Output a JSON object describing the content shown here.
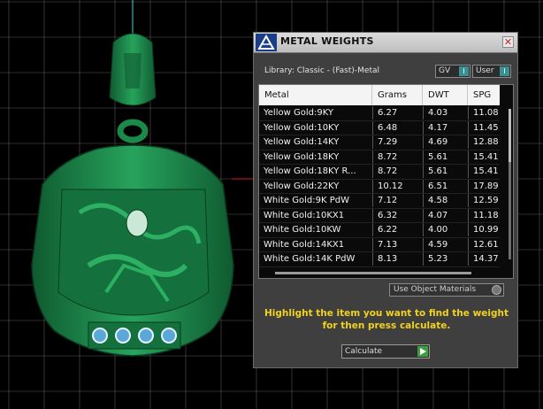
{
  "panel": {
    "title": "METAL WEIGHTS",
    "close_glyph": "✕",
    "library_label": "Library: Classic - (Fast)-Metal",
    "toggles": [
      {
        "label": "GV",
        "knob": "I"
      },
      {
        "label": "User",
        "knob": "I"
      }
    ],
    "table": {
      "headers": [
        "Metal",
        "Grams",
        "DWT",
        "SPG"
      ],
      "rows": [
        [
          "Yellow Gold:9KY",
          "6.27",
          "4.03",
          "11.08"
        ],
        [
          "Yellow Gold:10KY",
          "6.48",
          "4.17",
          "11.45"
        ],
        [
          "Yellow Gold:14KY",
          "7.29",
          "4.69",
          "12.88"
        ],
        [
          "Yellow Gold:18KY",
          "8.72",
          "5.61",
          "15.41"
        ],
        [
          "Yellow Gold:18KY R...",
          "8.72",
          "5.61",
          "15.41"
        ],
        [
          "Yellow Gold:22KY",
          "10.12",
          "6.51",
          "17.89"
        ],
        [
          "White Gold:9K PdW",
          "7.12",
          "4.58",
          "12.59"
        ],
        [
          "White Gold:10KX1",
          "6.32",
          "4.07",
          "11.18"
        ],
        [
          "White Gold:10KW",
          "6.22",
          "4.00",
          "10.99"
        ],
        [
          "White Gold:14KX1",
          "7.13",
          "4.59",
          "12.61"
        ],
        [
          "White Gold:14K PdW",
          "8.13",
          "5.23",
          "14.37"
        ]
      ]
    },
    "use_object_materials": "Use Object Materials",
    "instruction_line1": "Highlight the item you want to find the weight",
    "instruction_line2": "for then press calculate.",
    "calculate_label": "Calculate"
  },
  "icons": [
    "app-logo-icon",
    "close-icon",
    "play-arrow-icon",
    "radio-icon"
  ],
  "colors": {
    "model": "#1f8a4c",
    "grid": "#5a5a5a",
    "instruction": "#f2d21b",
    "accent": "#3a8f93",
    "calculate_arrow": "#3c9e3c",
    "gem": "#5aa8d8"
  }
}
